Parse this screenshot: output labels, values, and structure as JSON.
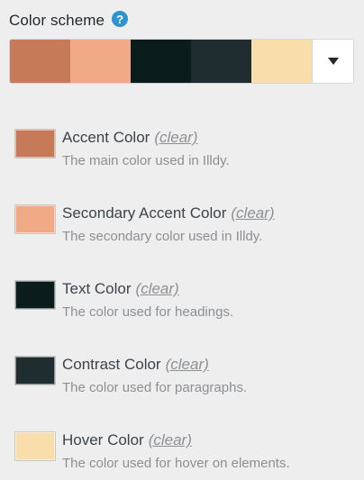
{
  "scheme": {
    "title": "Color scheme",
    "help_icon": "?",
    "help_icon_name": "help-icon",
    "dropdown_icon": "chevron-down-icon",
    "palette": [
      "#c77a57",
      "#f1aa86",
      "#0b1c1d",
      "#1f2d31",
      "#f8deab"
    ]
  },
  "colors": [
    {
      "label": "Accent Color",
      "clear": "(clear)",
      "description": "The main color used in Illdy.",
      "value": "#c77a57"
    },
    {
      "label": "Secondary Accent Color",
      "clear": "(clear)",
      "description": "The secondary color used in Illdy.",
      "value": "#f1aa86"
    },
    {
      "label": "Text Color",
      "clear": "(clear)",
      "description": "The color used for headings.",
      "value": "#0b1c1d"
    },
    {
      "label": "Contrast Color",
      "clear": "(clear)",
      "description": "The color used for paragraphs.",
      "value": "#1f2d31"
    },
    {
      "label": "Hover Color",
      "clear": "(clear)",
      "description": "The color used for hover on elements.",
      "value": "#f8deab"
    }
  ]
}
